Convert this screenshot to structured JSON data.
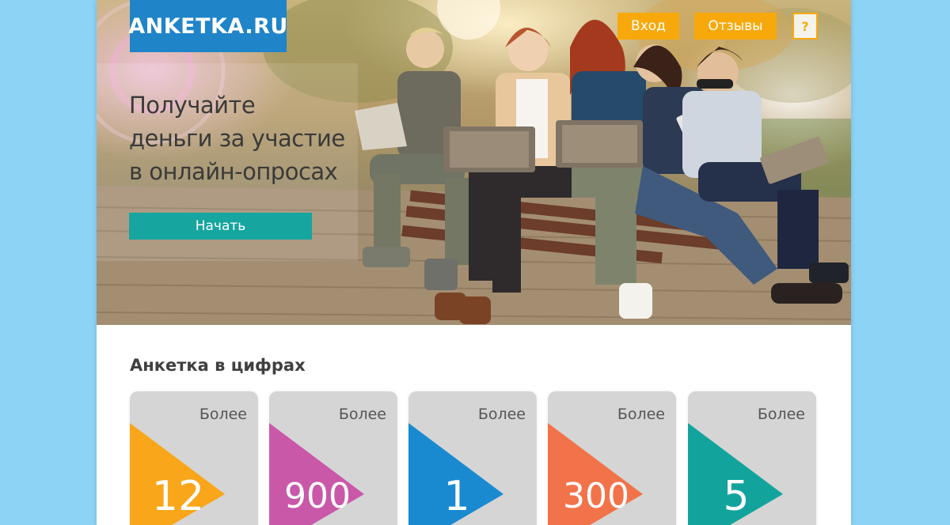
{
  "header": {
    "logo": "ANKETKA.RU",
    "nav": {
      "login": "Вход",
      "reviews": "Отзывы",
      "help": "?"
    }
  },
  "hero": {
    "headline": "Получайте\nденьги за участие\nв онлайн-опросах",
    "cta": "Начать"
  },
  "stats": {
    "title": "Анкетка в цифрах",
    "cards": [
      {
        "prefix": "Более",
        "value": "12",
        "color": "#f9a61b"
      },
      {
        "prefix": "Более",
        "value": "900",
        "color": "#c958a9"
      },
      {
        "prefix": "Более",
        "value": "1",
        "color": "#1a8ad0"
      },
      {
        "prefix": "Более",
        "value": "300",
        "color": "#f2734a"
      },
      {
        "prefix": "Более",
        "value": "5",
        "color": "#12a49c"
      }
    ]
  },
  "colors": {
    "background": "#8cd3f5",
    "logo": "#1f84c8",
    "nav": "#f7a90c",
    "cta": "#17a59f"
  }
}
